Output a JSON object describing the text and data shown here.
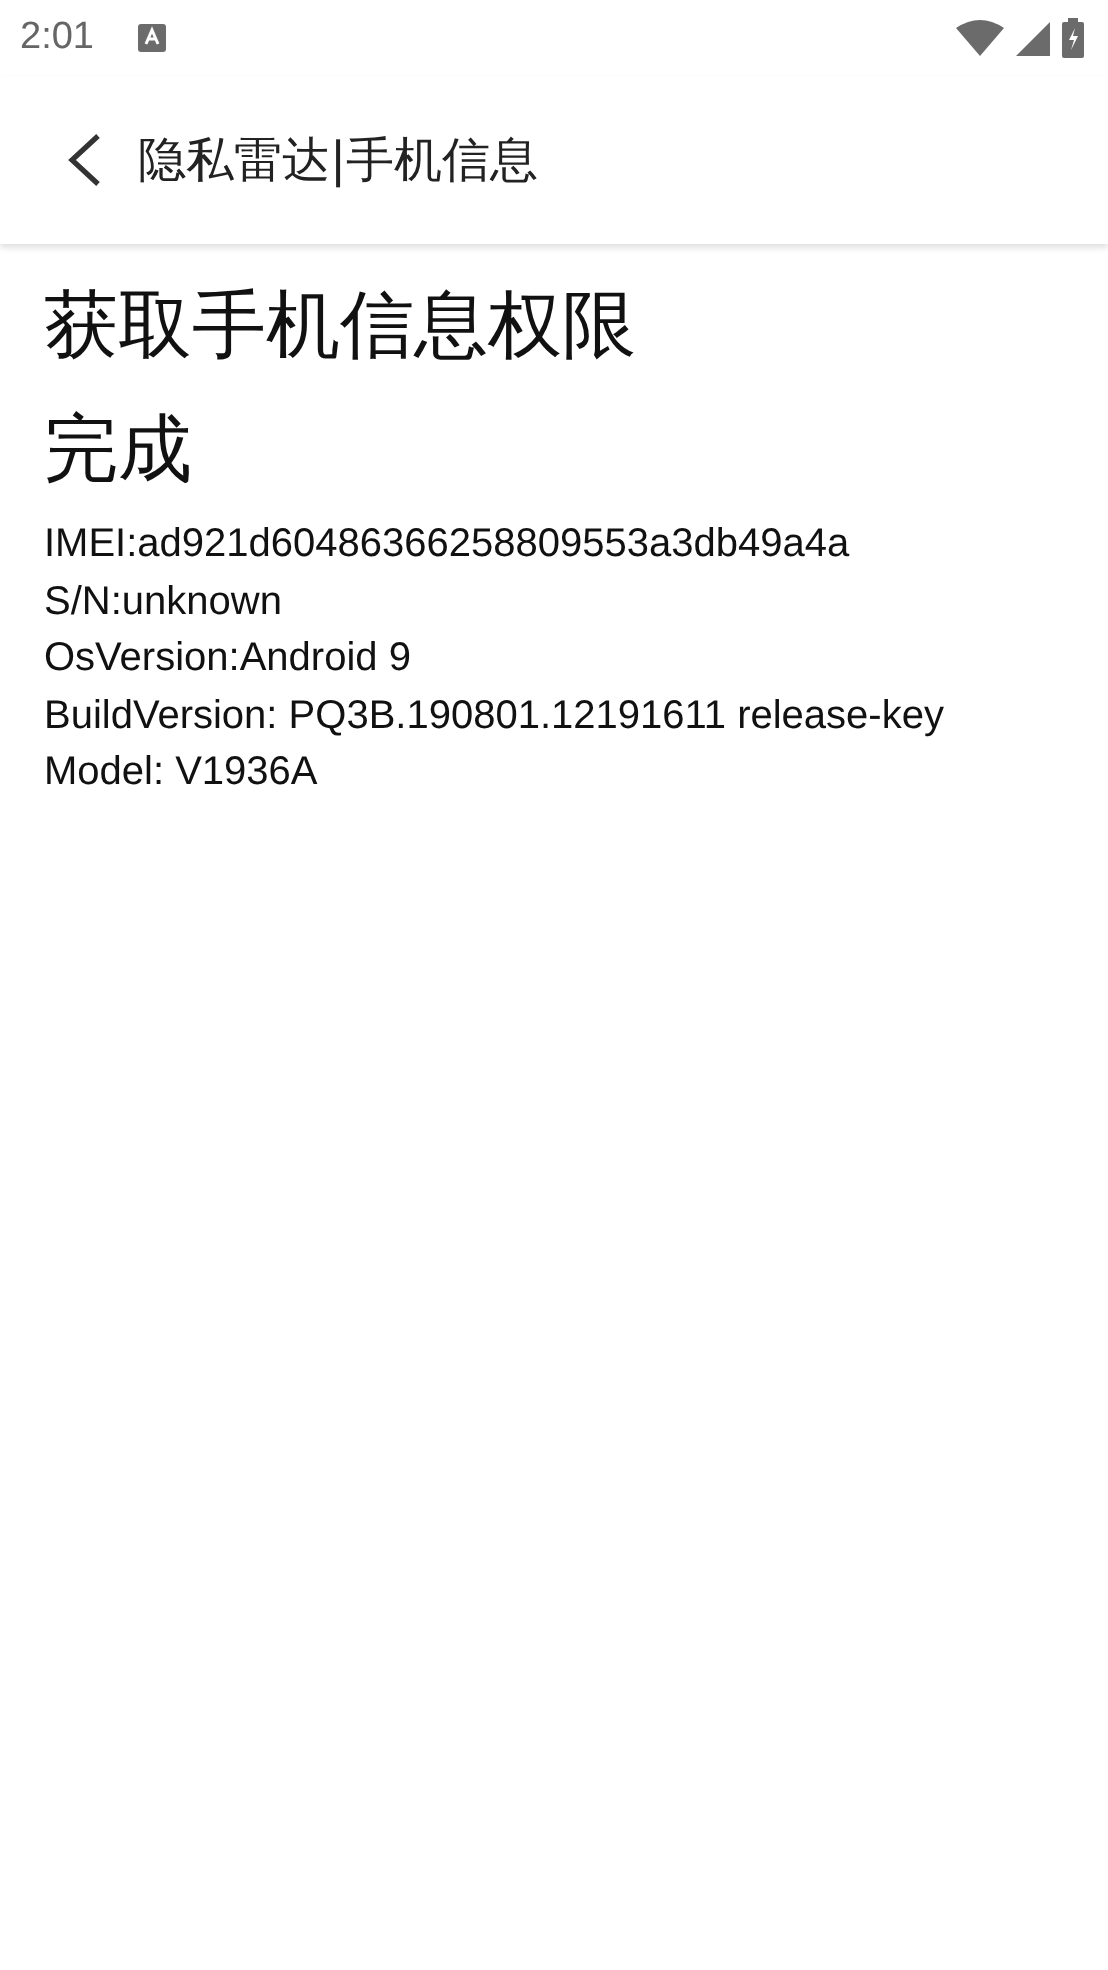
{
  "status_bar": {
    "time": "2:01"
  },
  "toolbar": {
    "title": "隐私雷达|手机信息"
  },
  "heading_lines": [
    "获取手机信息权限",
    "完成"
  ],
  "info_lines": [
    "IMEI:ad921d60486366258809553a3db49a4a",
    "S/N:unknown",
    "OsVersion:Android 9",
    "BuildVersion: PQ3B.190801.12191611 release-key",
    "Model: V1936A"
  ]
}
